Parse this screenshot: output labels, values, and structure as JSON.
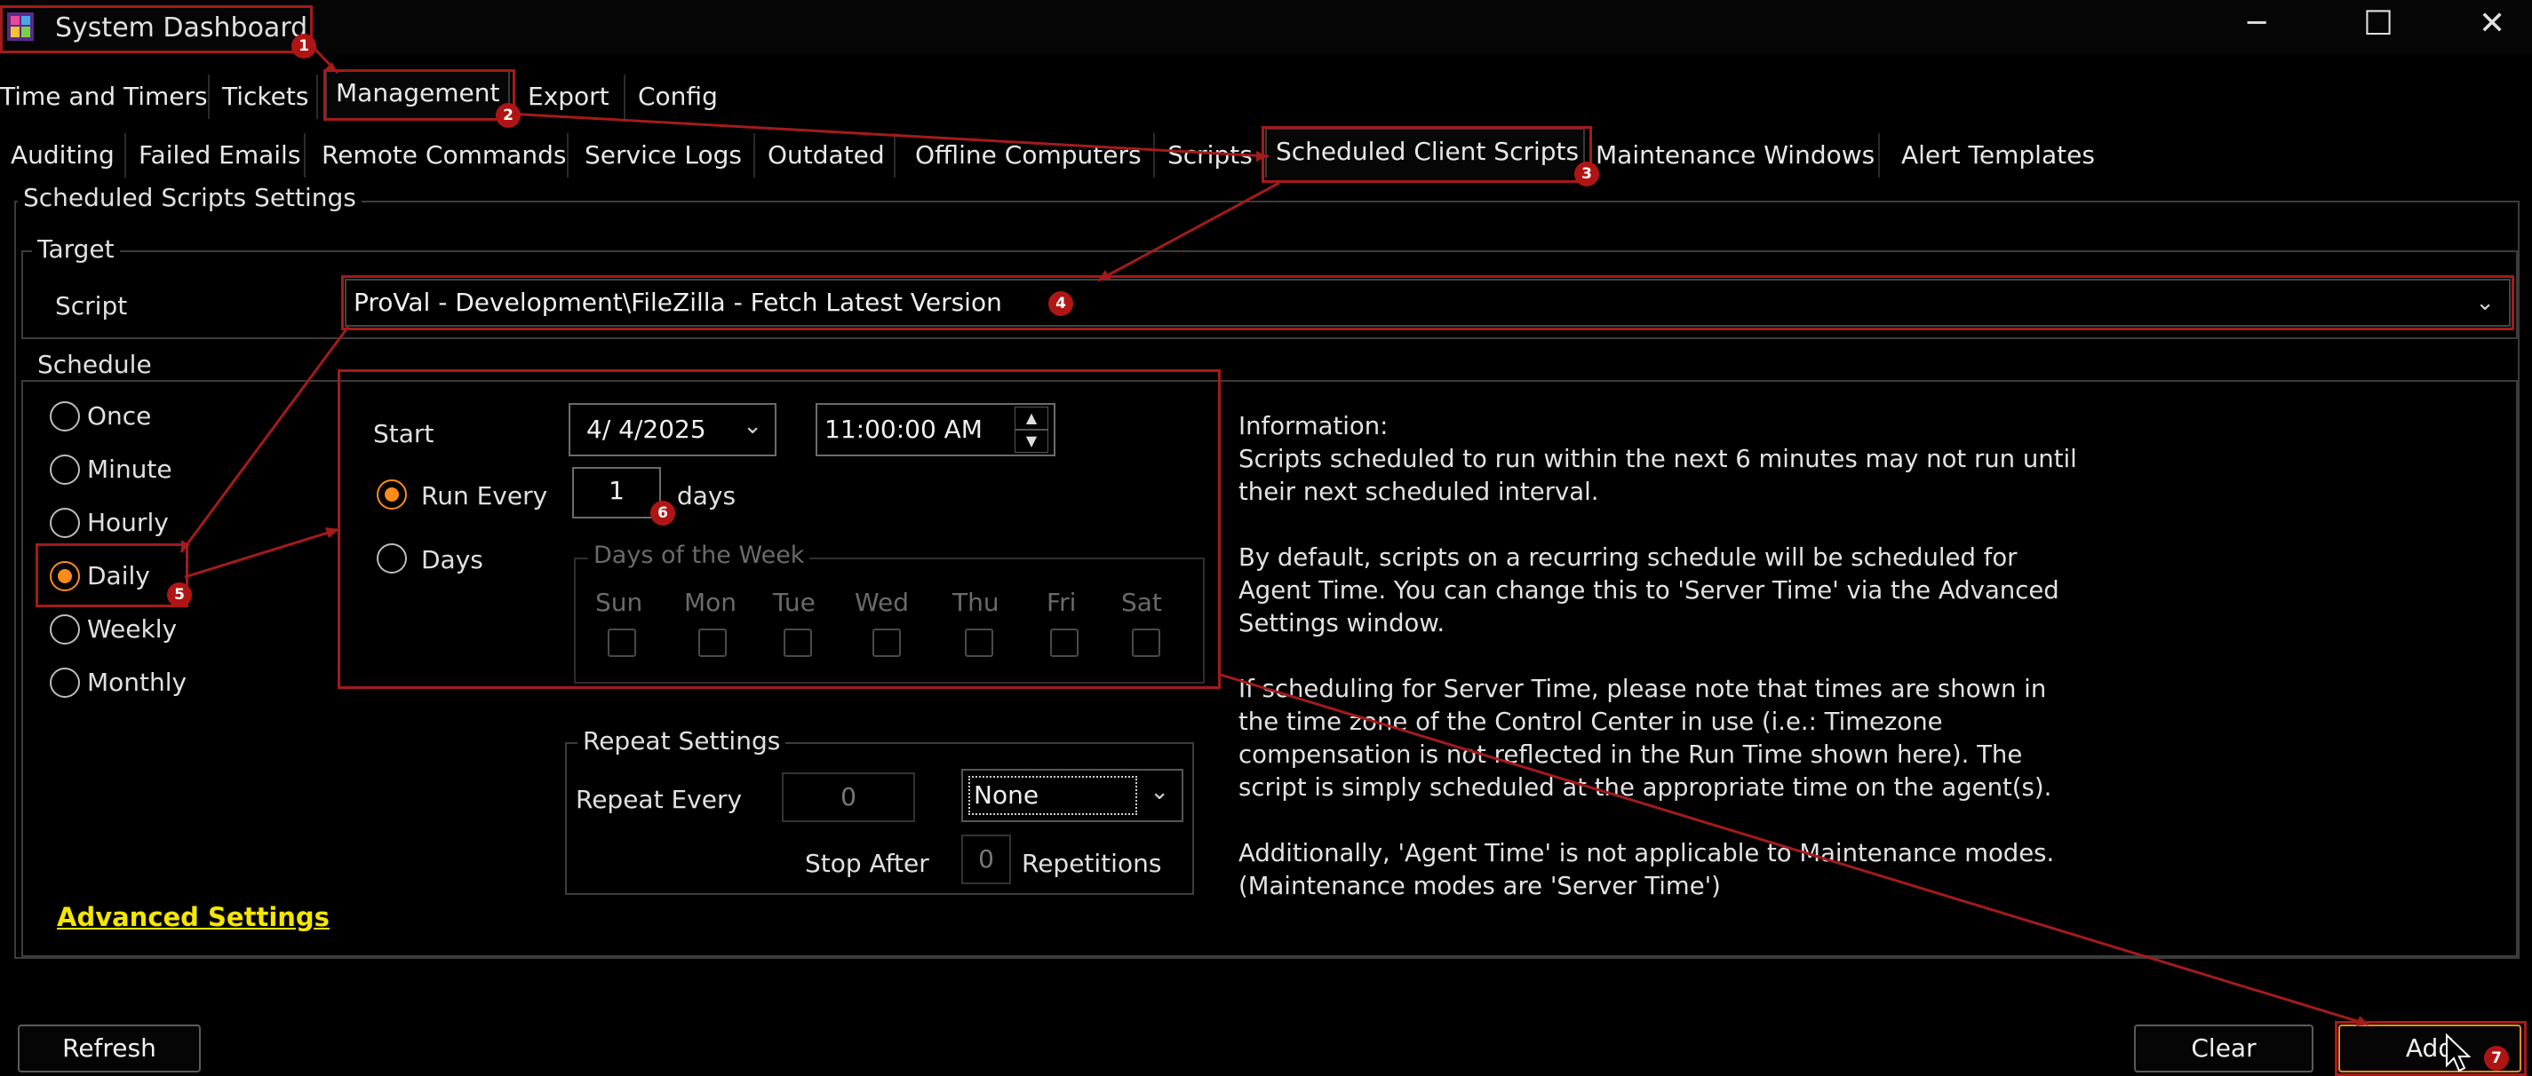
{
  "window": {
    "title": "System Dashboard",
    "app_icon": "dashboard-app-icon",
    "controls": {
      "minimize": "─",
      "maximize": "☐",
      "close": "✕"
    }
  },
  "main_tabs": [
    "Time and Timers",
    "Tickets",
    "Management",
    "Export",
    "Config"
  ],
  "sub_tabs": [
    "Auditing",
    "Failed Emails",
    "Remote Commands",
    "Service Logs",
    "Outdated",
    "Offline Computers",
    "Scripts",
    "Scheduled Client Scripts",
    "Maintenance Windows",
    "Alert Templates"
  ],
  "settings": {
    "group_title": "Scheduled Scripts Settings",
    "target_title": "Target",
    "script_label": "Script",
    "script_value": "ProVal - Development\\FileZilla - Fetch Latest Version",
    "schedule_title": "Schedule",
    "schedule_options": [
      "Once",
      "Minute",
      "Hourly",
      "Daily",
      "Weekly",
      "Monthly"
    ],
    "schedule_selected": "Daily",
    "start_label": "Start",
    "start_date": "4/  4/2025",
    "start_time": "11:00:00 AM",
    "run_every_label": "Run Every",
    "run_every_value": "1",
    "run_every_unit": "days",
    "days_label": "Days",
    "days_of_week_title": "Days of the Week",
    "weekdays": [
      "Sun",
      "Mon",
      "Tue",
      "Wed",
      "Thu",
      "Fri",
      "Sat"
    ],
    "repeat_title": "Repeat Settings",
    "repeat_every_label": "Repeat Every",
    "repeat_every_value": "0",
    "repeat_unit_value": "None",
    "stop_after_label": "Stop After",
    "stop_after_value": "0",
    "repetitions_label": "Repetitions",
    "advanced_settings_link": "Advanced Settings",
    "information_title": "Information:",
    "info_p1_l1": "Scripts scheduled to run within the next 6 minutes may not run until",
    "info_p1_l2": "their next scheduled interval.",
    "info_p2_l1": "By default, scripts on a recurring schedule will be scheduled for",
    "info_p2_l2": "Agent Time. You can change this to 'Server Time' via the Advanced",
    "info_p2_l3": "Settings window.",
    "info_p3_l1": "If scheduling for Server Time, please note that times are shown in",
    "info_p3_l2": "the time zone of the Control Center in use (i.e.: Timezone",
    "info_p3_l3": "compensation is not reflected in the Run Time shown here). The",
    "info_p3_l4": "script is simply scheduled at the appropriate time on the agent(s).",
    "info_p4_l1": "Additionally, 'Agent Time' is not applicable to Maintenance modes.",
    "info_p4_l2": "(Maintenance modes are 'Server Time')"
  },
  "footer": {
    "refresh": "Refresh",
    "clear": "Clear",
    "add": "Add"
  },
  "annotations": [
    "1",
    "2",
    "3",
    "4",
    "5",
    "6",
    "7"
  ],
  "colors": {
    "accent": "#ff8c1a",
    "annotation": "#a31b1b",
    "link": "#f5e600"
  }
}
